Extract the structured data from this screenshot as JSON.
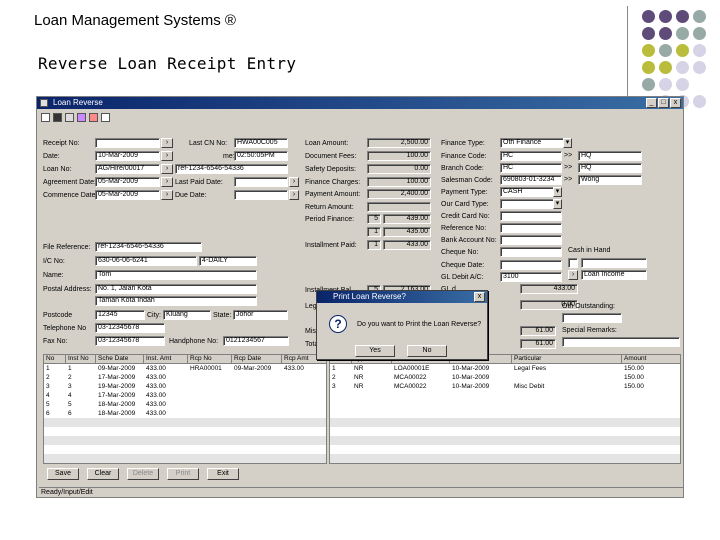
{
  "slide": {
    "title": "Loan Management Systems ®",
    "subtitle": "Reverse Loan Receipt Entry"
  },
  "colors": {
    "purple": "#5e4b79",
    "sage": "#98aaa6",
    "olive": "#b9bd3b",
    "lavender": "#d7d3e6"
  },
  "window": {
    "title": "Loan Reverse",
    "btn_min": "_",
    "btn_max": "□",
    "btn_close": "x"
  },
  "left": {
    "receipt_no_label": "Receipt No:",
    "date_label": "Date:",
    "date_value": "10-Mar-2009",
    "loan_no_label": "Loan No:",
    "loan_no_value": "AG/Hire/00017",
    "agreement_date_label": "Agreement Date:",
    "agreement_date_value": "05-Mar-2009",
    "commence_date_label": "Commence Date:",
    "commence_date_value": "05-Mar-2009",
    "last_cn_label": "Last CN No:",
    "last_cn_value": "HWA00C005",
    "time_label": "me:",
    "time_value": "02:50:05PM",
    "ref_value": "ref-1234-6546-54336",
    "last_paid_label": "Last Paid Date:",
    "due_date_label": "Due Date:",
    "file_ref_label": "File Reference:",
    "file_ref_value": "ref-1234-6546-54336",
    "ic_label": "I/C No:",
    "ic_value": "630-06-06-6241",
    "ic_type": "4-DAILY",
    "name_label": "Name:",
    "name_value": "Tom",
    "postal_label": "Postal Address:",
    "postal_line1": "No. 1, Jalan Kota",
    "postal_line2": "Taman Kota Indah",
    "postcode_label": "Postcode",
    "postcode_value": "12345",
    "city_label": "City:",
    "city_value": "Kluang",
    "state_label": "State:",
    "state_value": "Johor",
    "tel_label": "Telephone No",
    "tel_value": "03-12345678",
    "handphone_label": "Handphone No:",
    "handphone_value": "0121234567",
    "fax_label": "Fax No:",
    "fax_value": "03-12345678"
  },
  "middle": {
    "loan_amount_label": "Loan Amount:",
    "loan_amount": "2,500.00",
    "document_fees_label": "Document Fees:",
    "document_fees": "100.00",
    "safety_deposits_label": "Safety Deposits:",
    "safety_deposits": "0.00",
    "finance_charges_label": "Finance Charges:",
    "finance_charges": "100.00",
    "payment_amount_label": "Payment Amount:",
    "payment_amount": "2,400.00",
    "return_amount_label": "Return Amount:",
    "period_finance_label": "Period Finance:",
    "period_1_n": "5",
    "period_1_v": "439.00",
    "period_2_n": "1",
    "period_2_v": "435.00",
    "installment_label": "Installment Paid:",
    "period_3_n": "1",
    "period_3_v": "433.00",
    "inst_bal_label": "Installment Bal.",
    "inst_bal_n": "5",
    "inst_bal_v": "2,163.00",
    "lega_label": "Lega",
    "misc_label": "Misc",
    "total_label": "Total"
  },
  "right": {
    "finance_type_label": "Finance Type:",
    "finance_type_value": "Oth Finance",
    "finance_code_label": "Finance Code:",
    "finance_code_value": "HC",
    "branch_code_label": "Branch Code:",
    "branch_code_value": "HC",
    "salesman_code_label": "Salesman Code:",
    "salesman_code_value": "690803-01-3234",
    "payment_type_label": "Payment Type:",
    "payment_type_value": "CASH",
    "our_card_type_label": "Our Card Type:",
    "credit_card_no_label": "Credit Card No:",
    "reference_no_label": "Reference No:",
    "bank_account_label": "Bank Account No:",
    "cheque_no_label": "Cheque No:",
    "cheque_date_label": "Cheque Date:",
    "gl_debit_label": "GL Debit A/C:",
    "gl_debit_value": "3100",
    "code1": "HQ",
    "code2": "HQ",
    "code3": "Wong",
    "cash_in_hand_label": "Cash in Hand",
    "loan_income_label": "Loan Income",
    "loan_income_value": "433.00",
    "zero_val": "0.00",
    "other_outstanding_label": "Oth Outstanding:",
    "special_remarks_label": "Special Remarks:",
    "val_6100a": "61.00",
    "val_6100b": "61.00",
    "gl_extra": "GL d"
  },
  "dialog": {
    "title": "Print Loan Reverse?",
    "message": "Do you want to Print the Loan Reverse?",
    "yes": "Yes",
    "no": "No"
  },
  "grid_left": {
    "headers": [
      "No",
      "Inst No",
      "Sche Date",
      "Inst. Amt",
      "Rcp No",
      "Rcp Date",
      "Rcp Amt"
    ],
    "rows": [
      [
        "1",
        "1",
        "09-Mar-2009",
        "433.00",
        "HRA00001",
        "09-Mar-2009",
        "433.00"
      ],
      [
        "2",
        "2",
        "17-Mar-2009",
        "433.00",
        "",
        "",
        ""
      ],
      [
        "3",
        "3",
        "19-Mar-2009",
        "433.00",
        "",
        "",
        ""
      ],
      [
        "4",
        "4",
        "17-Mar-2009",
        "433.00",
        "",
        "",
        ""
      ],
      [
        "5",
        "5",
        "18-Mar-2009",
        "433.00",
        "",
        "",
        ""
      ],
      [
        "6",
        "6",
        "18-Mar-2009",
        "433.00",
        "",
        "",
        ""
      ]
    ]
  },
  "grid_right": {
    "headers": [
      "No",
      "Type",
      "Ref No",
      "Date",
      "Particular",
      "Amount"
    ],
    "rows": [
      [
        "1",
        "NR",
        "LOA00001E",
        "10-Mar-2009",
        "Legal Fees",
        "150.00"
      ],
      [
        "2",
        "NR",
        "MCA00022",
        "10-Mar-2009",
        "",
        "150.00"
      ],
      [
        "3",
        "NR",
        "MCA00022",
        "10-Mar-2009",
        "Misc Debit",
        "150.00"
      ]
    ]
  },
  "buttons": {
    "save": "Save",
    "clear": "Clear",
    "delete": "Delete",
    "print": "Print",
    "exit": "Exit"
  },
  "status_text": "Ready/Input/Edit"
}
